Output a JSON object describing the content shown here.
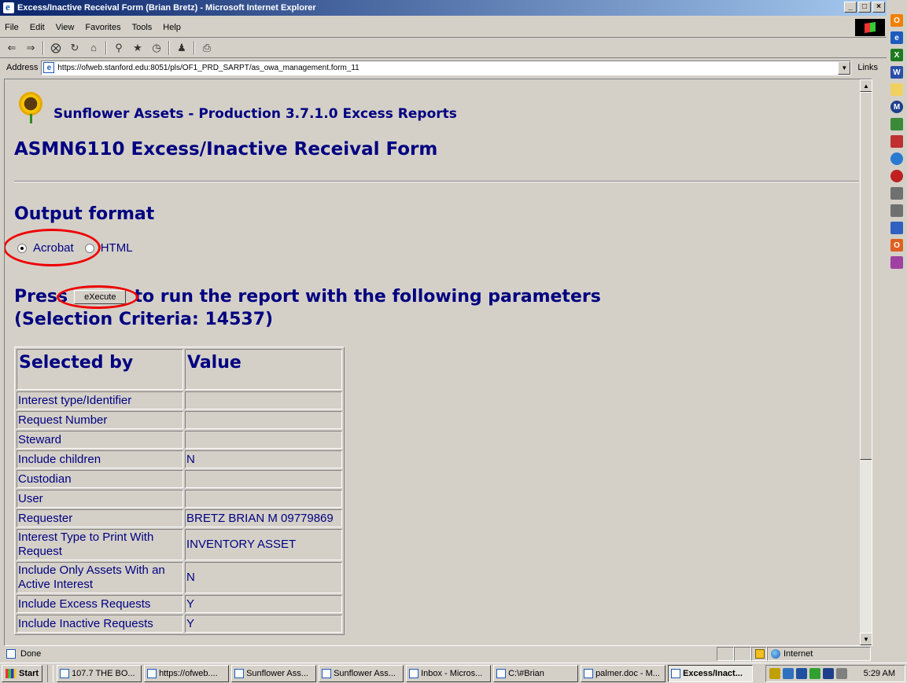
{
  "window": {
    "title": "Excess/Inactive Receival Form (Brian Bretz) - Microsoft Internet Explorer",
    "min_label": "_",
    "max_label": "□",
    "close_label": "×"
  },
  "menu": [
    "File",
    "Edit",
    "View",
    "Favorites",
    "Tools",
    "Help"
  ],
  "address": {
    "label": "Address",
    "url": "https://ofweb.stanford.edu:8051/pls/OF1_PRD_SARPT/as_owa_management.form_11",
    "links_label": "Links"
  },
  "page": {
    "brand": "Sunflower Assets - Production 3.7.1.0 Excess Reports",
    "form_title": "ASMN6110 Excess/Inactive Receival Form",
    "output_format_title": "Output format",
    "radio_acrobat": "Acrobat",
    "radio_html": "HTML",
    "press_text": "Press",
    "execute_label": "eXecute",
    "run_text": "to run the report with the following parameters",
    "criteria_text": "(Selection Criteria: 14537)",
    "table": {
      "headers": [
        "Selected by",
        "Value"
      ],
      "rows": [
        {
          "key": "Interest type/Identifier",
          "value": ""
        },
        {
          "key": "Request Number",
          "value": ""
        },
        {
          "key": "Steward",
          "value": ""
        },
        {
          "key": "Include children",
          "value": "N"
        },
        {
          "key": "Custodian",
          "value": ""
        },
        {
          "key": "User",
          "value": ""
        },
        {
          "key": "Requester",
          "value": "BRETZ BRIAN M 09779869"
        },
        {
          "key": "Interest Type to Print With Request",
          "value": "INVENTORY ASSET"
        },
        {
          "key": "Include Only Assets With an Active Interest",
          "value": "N"
        },
        {
          "key": "Include Excess Requests",
          "value": "Y"
        },
        {
          "key": "Include Inactive Requests",
          "value": "Y"
        }
      ]
    }
  },
  "status": {
    "text": "Done",
    "zone": "Internet"
  },
  "taskbar": {
    "start_label": "Start",
    "tasks": [
      "107.7 THE BO...",
      "https://ofweb....",
      "Sunflower Ass...",
      "Sunflower Ass...",
      "Inbox - Micros...",
      "C:\\#Brian",
      "palmer.doc - M...",
      "Excess/Inact..."
    ],
    "clock": "5:29 AM"
  },
  "colors": {
    "page_text": "#000080",
    "highlight": "#e00000",
    "titlebar_start": "#0a246a",
    "titlebar_end": "#a6caf0"
  }
}
